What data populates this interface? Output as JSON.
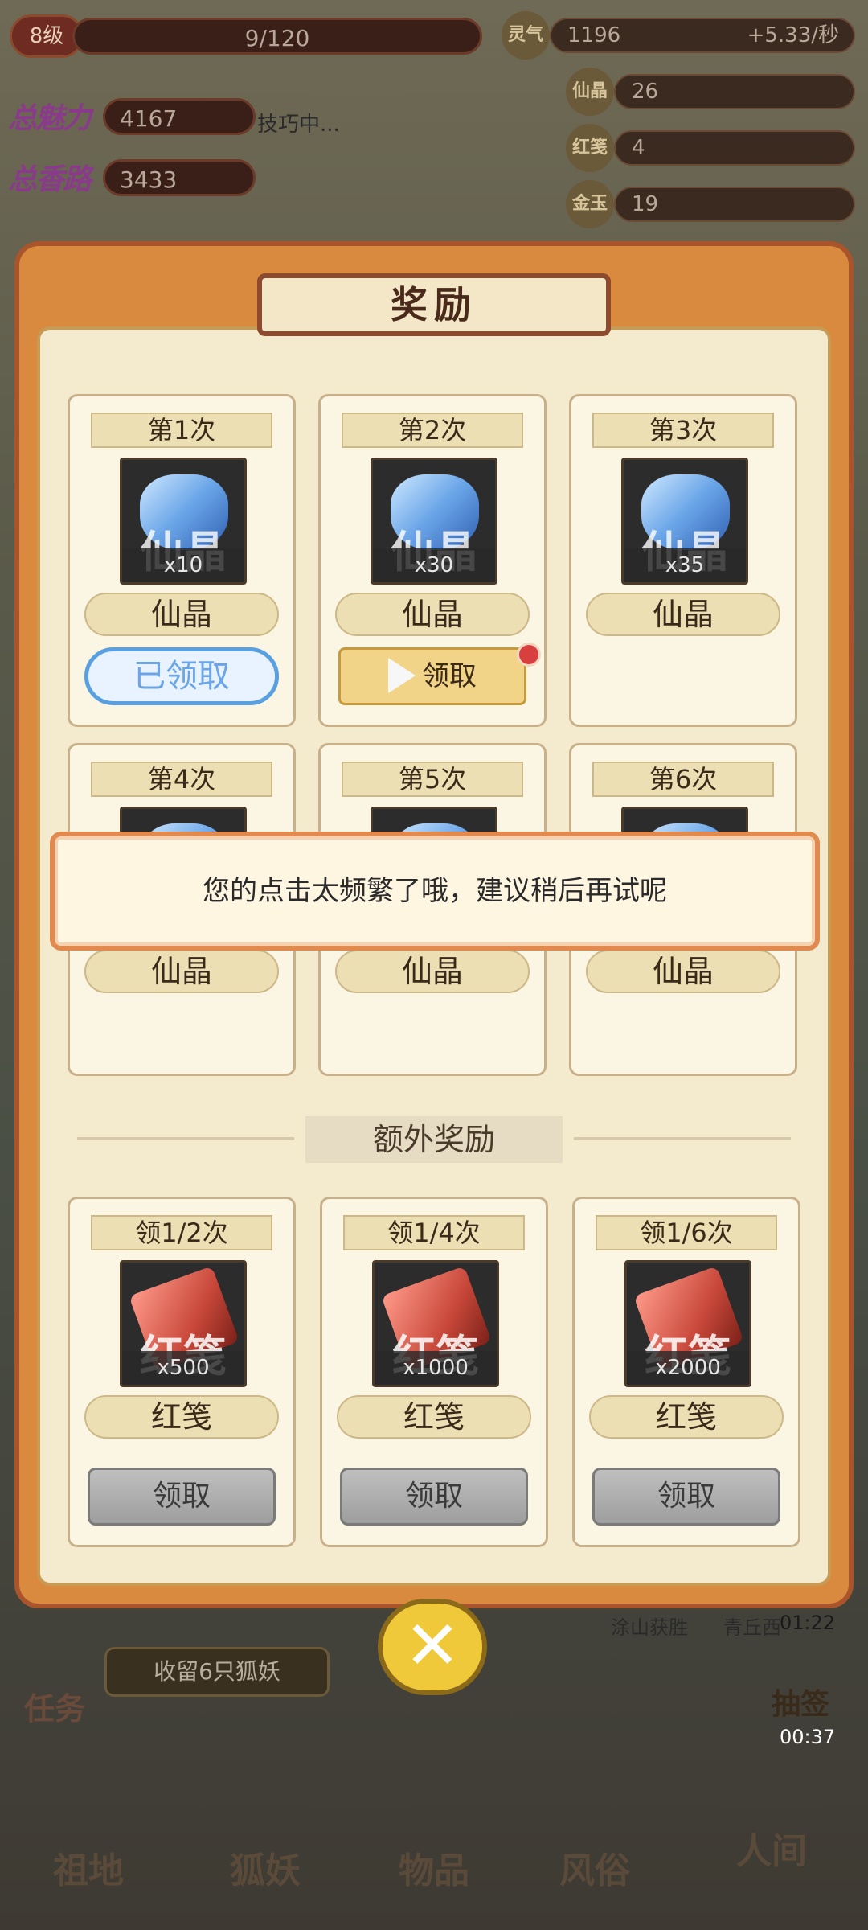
{
  "hud": {
    "level": "8级",
    "xp": "9/120",
    "charm_label": "总魅力",
    "charm_value": "4167",
    "charm_status": "技巧中...",
    "power_label": "总香路",
    "power_value": "3433",
    "resources": [
      {
        "icon_text": "灵气",
        "value": "1196",
        "rate": "+5.33/秒"
      },
      {
        "icon_text": "仙晶",
        "value": "26"
      },
      {
        "icon_text": "红笺",
        "value": "4"
      },
      {
        "icon_text": "金玉",
        "value": "19"
      }
    ]
  },
  "modal": {
    "title": "奖励",
    "cards": [
      {
        "header": "第1次",
        "item": "仙晶",
        "qty": "x10",
        "icon": "gem-icon",
        "button": "已领取",
        "state": "claimed"
      },
      {
        "header": "第2次",
        "item": "仙晶",
        "qty": "x30",
        "icon": "gem-icon",
        "button": "领取",
        "state": "claim"
      },
      {
        "header": "第3次",
        "item": "仙晶",
        "qty": "x35",
        "icon": "gem-icon",
        "button": "",
        "state": "locked"
      },
      {
        "header": "第4次",
        "item": "仙晶",
        "state": "locked"
      },
      {
        "header": "第5次",
        "item": "仙晶",
        "state": "locked"
      },
      {
        "header": "第6次",
        "item": "仙晶",
        "state": "locked"
      }
    ],
    "extra_title": "额外奖励",
    "extra_cards": [
      {
        "header": "领1/2次",
        "item": "红笺",
        "qty": "x500",
        "icon": "red-paper-icon",
        "button": "领取"
      },
      {
        "header": "领1/4次",
        "item": "红笺",
        "qty": "x1000",
        "icon": "red-paper-icon",
        "button": "领取"
      },
      {
        "header": "领1/6次",
        "item": "红笺",
        "qty": "x2000",
        "icon": "red-paper-icon",
        "button": "领取"
      }
    ]
  },
  "toast": "您的点击太频繁了哦，建议稍后再试呢",
  "bottom": {
    "task_icon_label": "任务",
    "task_progress": "收留6只狐妖",
    "tags": [
      "涂山获胜",
      "青丘西"
    ],
    "timer1": "01:22",
    "timer2": "00:37",
    "side_label": "抽签",
    "nav": [
      "祖地",
      "狐妖",
      "物品",
      "风俗",
      "人间"
    ]
  },
  "colors": {
    "modal_frame": "#d98a3e",
    "panel": "#f4ebcf",
    "toast_border": "#e08a50",
    "claim_button": "#f1d487",
    "claimed_blue": "#5aa0e0"
  }
}
